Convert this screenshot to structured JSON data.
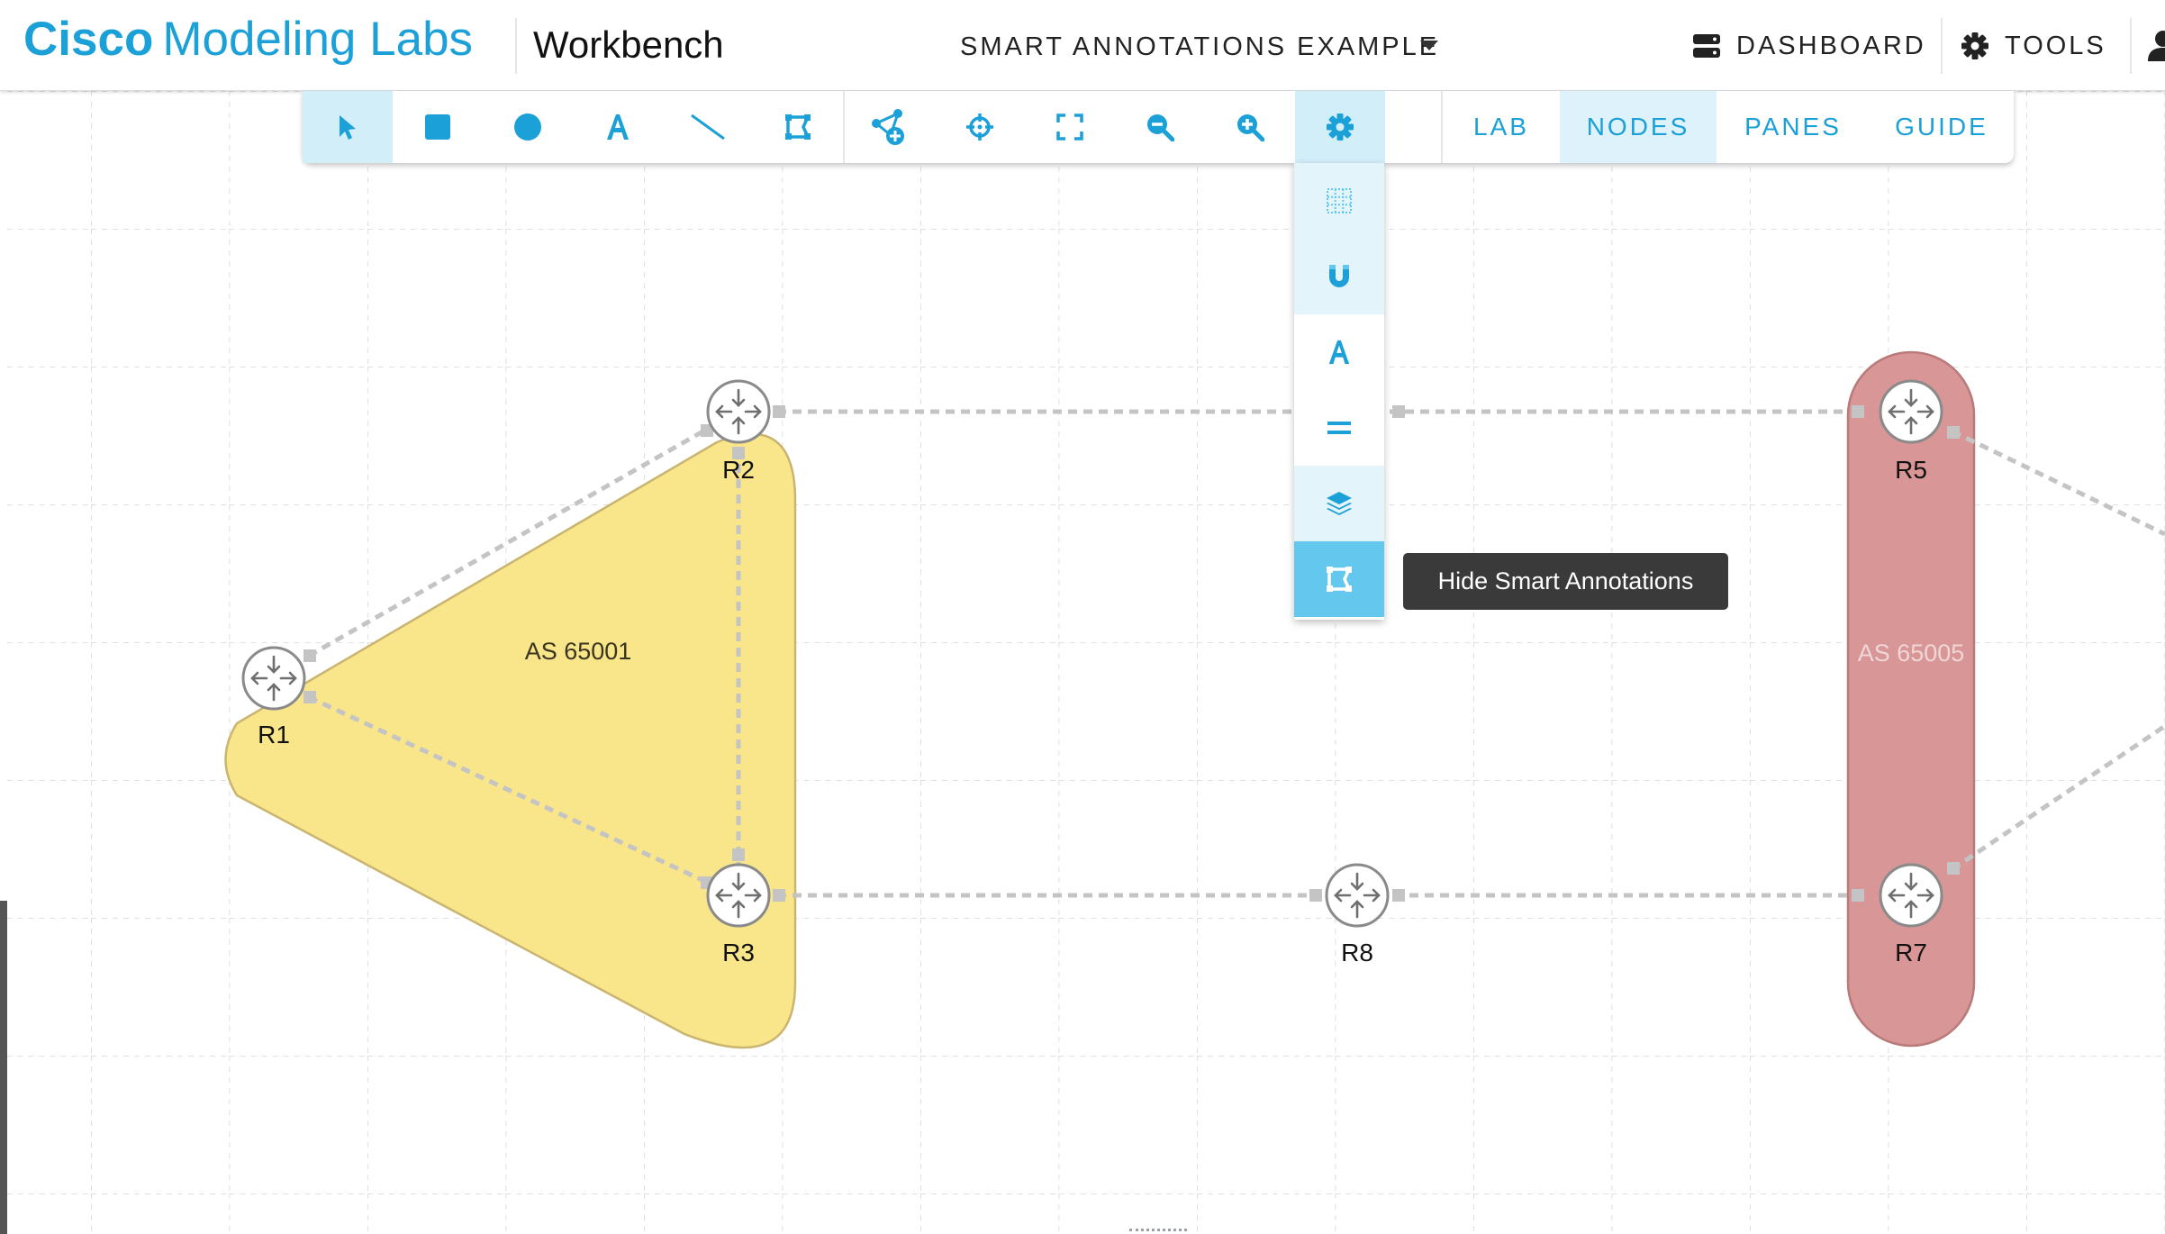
{
  "header": {
    "brand_bold": "Cisco",
    "brand_light": "Modeling Labs",
    "section": "Workbench",
    "lab_title": "SMART ANNOTATIONS EXAMPLE",
    "dashboard_label": "DASHBOARD",
    "tools_label": "TOOLS"
  },
  "toolbar": {
    "tools": [
      "pointer-icon",
      "rectangle-icon",
      "ellipse-icon",
      "text-icon",
      "line-icon",
      "smart-annotation-icon",
      "add-nodes-icon",
      "crosshair-icon",
      "fit-screen-icon",
      "zoom-out-icon",
      "zoom-in-icon",
      "gear-icon"
    ],
    "tabs": {
      "lab": "LAB",
      "nodes": "NODES",
      "panes": "PANES",
      "guide": "GUIDE"
    },
    "active_tab": "NODES"
  },
  "settings_menu": {
    "items": [
      "grid-icon",
      "magnet-icon",
      "text-icon",
      "equals-icon",
      "layers-icon",
      "smart-annotation-icon"
    ],
    "selected": "smart-annotation-icon"
  },
  "tooltip": {
    "text": "Hide Smart Annotations"
  },
  "topology": {
    "nodes": [
      {
        "id": "R1",
        "label": "R1"
      },
      {
        "id": "R2",
        "label": "R2"
      },
      {
        "id": "R3",
        "label": "R3"
      },
      {
        "id": "R5",
        "label": "R5"
      },
      {
        "id": "R7",
        "label": "R7"
      },
      {
        "id": "R8",
        "label": "R8"
      }
    ],
    "annotations": [
      {
        "label": "AS 65001",
        "color": "#f9e58a"
      },
      {
        "label": "AS 65005",
        "color": "#d89696"
      }
    ]
  },
  "colors": {
    "accent": "#1ba0d8",
    "active_tool": "#d2eef9",
    "selected_menu": "#63c7ee",
    "link": "#c4c4c4"
  }
}
